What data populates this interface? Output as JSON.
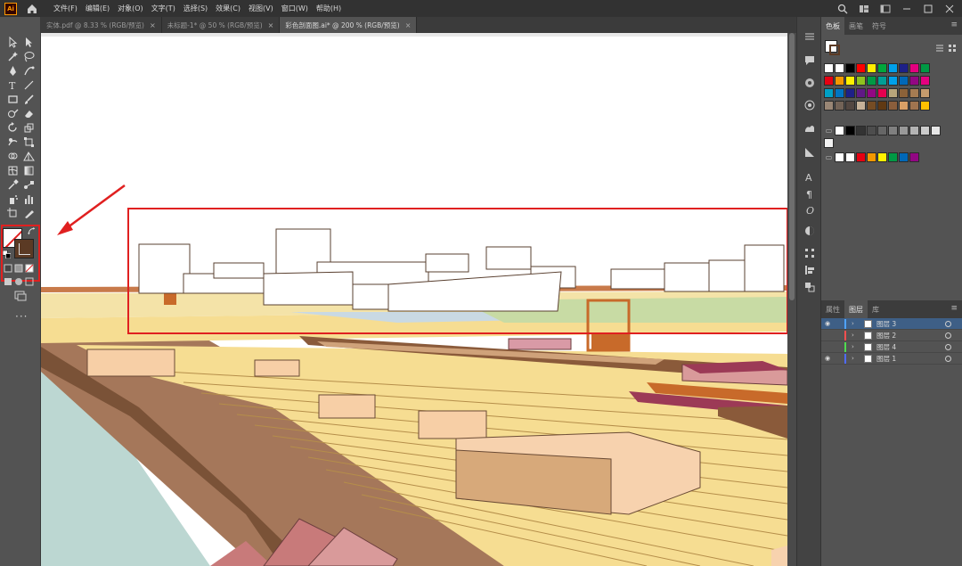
{
  "app": {
    "logo_text": "Ai"
  },
  "menu": [
    "文件(F)",
    "编辑(E)",
    "对象(O)",
    "文字(T)",
    "选择(S)",
    "效果(C)",
    "视图(V)",
    "窗口(W)",
    "帮助(H)"
  ],
  "tabs": [
    {
      "label": "实体.pdf @ 8.33 % (RGB/预览)",
      "close": "×",
      "active": false
    },
    {
      "label": "未标题-1* @ 50 % (RGB/预览)",
      "close": "×",
      "active": false
    },
    {
      "label": "彩色剖面图.ai* @ 200 % (RGB/预览)",
      "close": "×",
      "active": true
    }
  ],
  "swatches_panel": {
    "tabs": [
      "色板",
      "画笔",
      "符号"
    ],
    "rows": [
      [
        "#ffffff",
        "#ffffff",
        "#000000",
        "#ff0000",
        "#ffed00",
        "#00a73c",
        "#00a0e9",
        "#1d2088",
        "#e4007f",
        "#009944"
      ],
      [
        "#e60012",
        "#f39800",
        "#fff100",
        "#8fc31f",
        "#009944",
        "#009e96",
        "#00a0e9",
        "#0068b7",
        "#920783",
        "#e4007f"
      ],
      [
        "#00a0c6",
        "#0075c2",
        "#1d2088",
        "#601986",
        "#920783",
        "#e5004f",
        "#b8a57b",
        "#8c6239",
        "#a67c52",
        "#c69c6d"
      ],
      [
        "#998675",
        "#736357",
        "#534741",
        "#c7b299",
        "#754c24",
        "#603913",
        "#8b5e3c",
        "#d9a066",
        "#a0744f",
        "#ffc000"
      ],
      [
        "#ffffff",
        "#000000",
        "#333333",
        "#4d4d4d",
        "#666666",
        "#808080",
        "#999999",
        "#b3b3b3",
        "#cccccc",
        "#e6e6e6"
      ],
      [
        "#f2f2f2"
      ],
      [
        "#ffffff",
        "#ffffff",
        "#e60012",
        "#f39800",
        "#fff100",
        "#009944",
        "#0068b7",
        "#920783"
      ]
    ]
  },
  "layers_panel": {
    "tabs": [
      "属性",
      "图层",
      "库"
    ],
    "layers": [
      {
        "name": "图层 3",
        "visible": true,
        "color": "#4fa3ff",
        "selected": true
      },
      {
        "name": "图层 2",
        "visible": false,
        "color": "#ff4f4f",
        "selected": false
      },
      {
        "name": "图层 4",
        "visible": false,
        "color": "#4fdc4f",
        "selected": false
      },
      {
        "name": "图层 1",
        "visible": true,
        "color": "#4f6bff",
        "selected": false
      }
    ]
  },
  "colors": {
    "fill": "#ffffff",
    "stroke": "#5b3a24",
    "annotation": "#e02020"
  }
}
